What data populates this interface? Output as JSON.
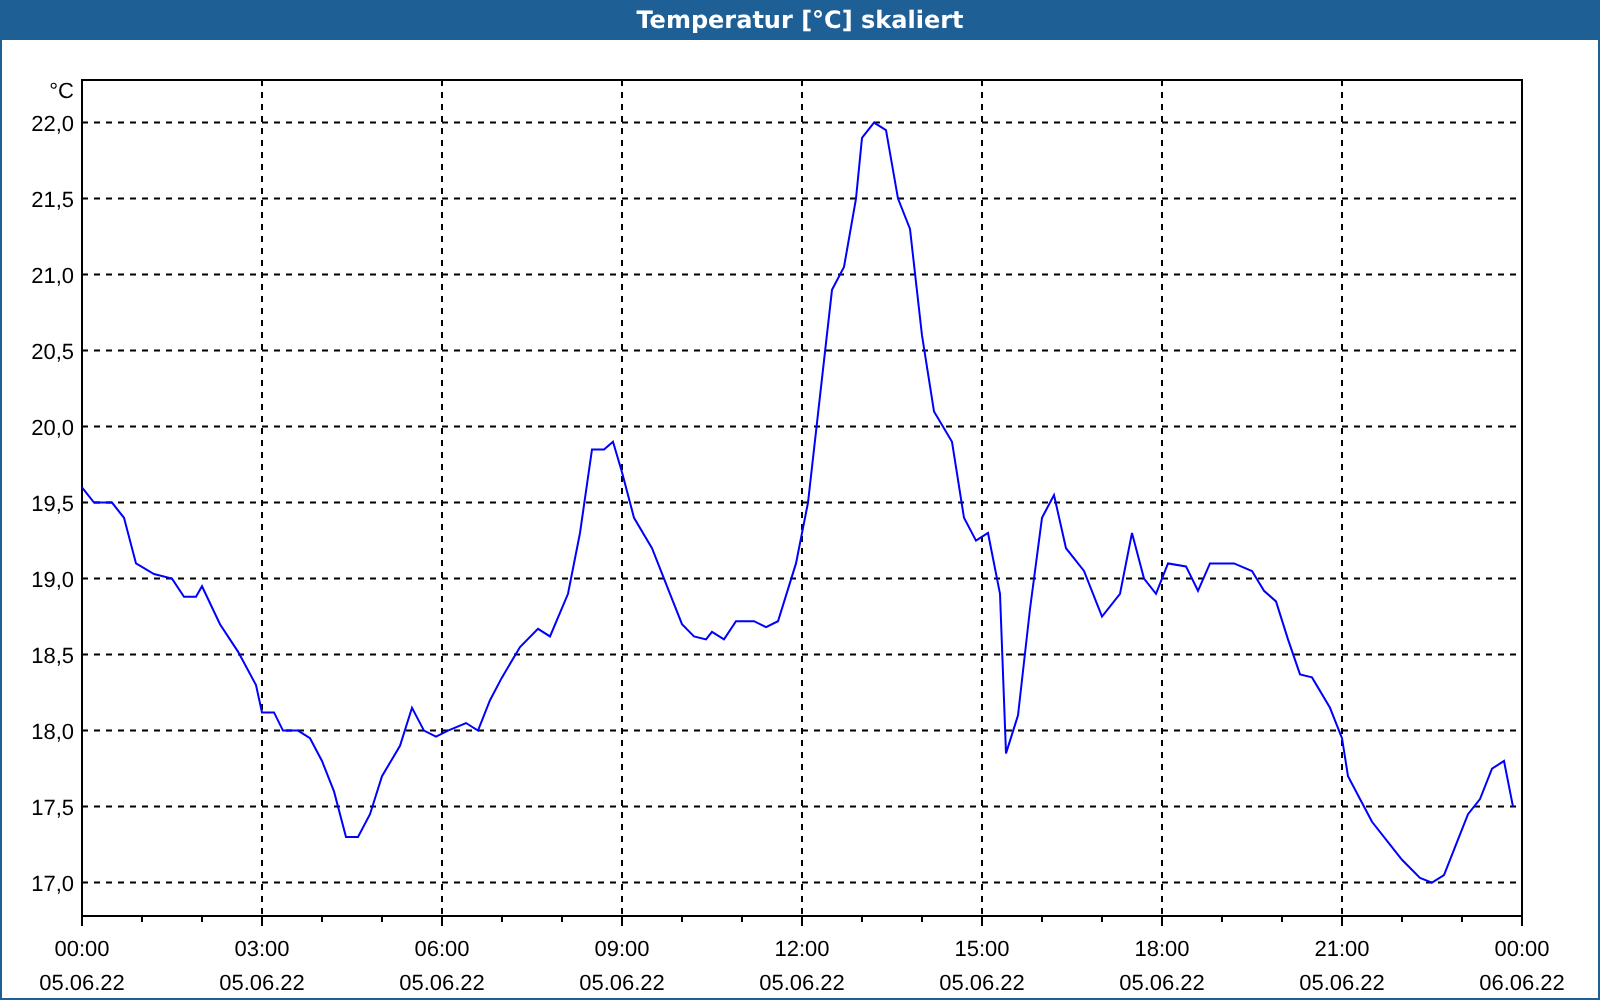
{
  "chart_data": {
    "type": "line",
    "title": "Temperatur [°C] skaliert",
    "ylabel": "°C",
    "xlim": [
      0,
      24
    ],
    "ylim": [
      16.78,
      22.28
    ],
    "x": [
      0,
      0.2,
      0.5,
      0.7,
      0.9,
      1.2,
      1.5,
      1.7,
      1.9,
      2.0,
      2.3,
      2.6,
      2.9,
      3.0,
      3.2,
      3.35,
      3.6,
      3.8,
      4.0,
      4.2,
      4.4,
      4.6,
      4.8,
      5.0,
      5.3,
      5.5,
      5.7,
      5.9,
      6.1,
      6.4,
      6.6,
      6.8,
      7.0,
      7.3,
      7.6,
      7.8,
      8.1,
      8.3,
      8.5,
      8.7,
      8.85,
      9.0,
      9.2,
      9.5,
      9.8,
      10.0,
      10.2,
      10.4,
      10.5,
      10.7,
      10.9,
      11.2,
      11.4,
      11.6,
      11.9,
      12.1,
      12.3,
      12.5,
      12.7,
      12.9,
      13.0,
      13.2,
      13.4,
      13.6,
      13.8,
      14.0,
      14.2,
      14.5,
      14.7,
      14.9,
      15.1,
      15.3,
      15.4,
      15.6,
      15.8,
      16.0,
      16.2,
      16.4,
      16.7,
      16.9,
      17.0,
      17.3,
      17.5,
      17.7,
      17.9,
      18.1,
      18.4,
      18.6,
      18.8,
      19.2,
      19.5,
      19.7,
      19.9,
      20.1,
      20.3,
      20.5,
      20.8,
      21.0,
      21.1,
      21.3,
      21.5,
      21.8,
      22.0,
      22.3,
      22.5,
      22.7,
      22.9,
      23.1,
      23.3,
      23.5,
      23.7,
      23.85
    ],
    "grid": true,
    "series": [
      {
        "color": "#0000ff",
        "values": [
          19.6,
          19.5,
          19.5,
          19.4,
          19.1,
          19.03,
          19.0,
          18.88,
          18.88,
          18.95,
          18.7,
          18.52,
          18.3,
          18.12,
          18.12,
          18.0,
          18.0,
          17.95,
          17.8,
          17.6,
          17.3,
          17.3,
          17.45,
          17.7,
          17.9,
          18.15,
          18.0,
          17.96,
          18.0,
          18.05,
          18.0,
          18.2,
          18.35,
          18.55,
          18.67,
          18.62,
          18.9,
          19.3,
          19.85,
          19.85,
          19.9,
          19.7,
          19.4,
          19.2,
          18.9,
          18.7,
          18.62,
          18.6,
          18.65,
          18.6,
          18.72,
          18.72,
          18.68,
          18.72,
          19.1,
          19.5,
          20.2,
          20.9,
          21.05,
          21.5,
          21.9,
          22.0,
          21.95,
          21.5,
          21.3,
          20.6,
          20.1,
          19.9,
          19.4,
          19.25,
          19.3,
          18.9,
          17.85,
          18.1,
          18.8,
          19.4,
          19.55,
          19.2,
          19.05,
          18.85,
          18.75,
          18.9,
          19.3,
          19.0,
          18.9,
          19.1,
          19.08,
          18.92,
          19.1,
          19.1,
          19.05,
          18.92,
          18.85,
          18.6,
          18.37,
          18.35,
          18.15,
          17.95,
          17.7,
          17.55,
          17.4,
          17.25,
          17.15,
          17.03,
          17.0,
          17.05,
          17.25,
          17.45,
          17.55,
          17.75,
          17.8,
          17.5
        ]
      }
    ],
    "yticks": [
      {
        "value": 17,
        "label": "17,0"
      },
      {
        "value": 17.5,
        "label": "17,5"
      },
      {
        "value": 18,
        "label": "18,0"
      },
      {
        "value": 18.5,
        "label": "18,5"
      },
      {
        "value": 19,
        "label": "19,0"
      },
      {
        "value": 19.5,
        "label": "19,5"
      },
      {
        "value": 20,
        "label": "20,0"
      },
      {
        "value": 20.5,
        "label": "20,5"
      },
      {
        "value": 21,
        "label": "21,0"
      },
      {
        "value": 21.5,
        "label": "21,5"
      },
      {
        "value": 22,
        "label": "22,0"
      }
    ],
    "xticks": [
      {
        "value": 0,
        "label": "00:00"
      },
      {
        "value": 3,
        "label": "03:00"
      },
      {
        "value": 6,
        "label": "06:00"
      },
      {
        "value": 9,
        "label": "09:00"
      },
      {
        "value": 12,
        "label": "12:00"
      },
      {
        "value": 15,
        "label": "15:00"
      },
      {
        "value": 18,
        "label": "18:00"
      },
      {
        "value": 21,
        "label": "21:00"
      },
      {
        "value": 24,
        "label": "00:00"
      }
    ]
  },
  "x_axis_dates": [
    "05.06.22",
    "05.06.22",
    "05.06.22",
    "05.06.22",
    "05.06.22",
    "05.06.22",
    "05.06.22",
    "05.06.22",
    "06.06.22"
  ]
}
